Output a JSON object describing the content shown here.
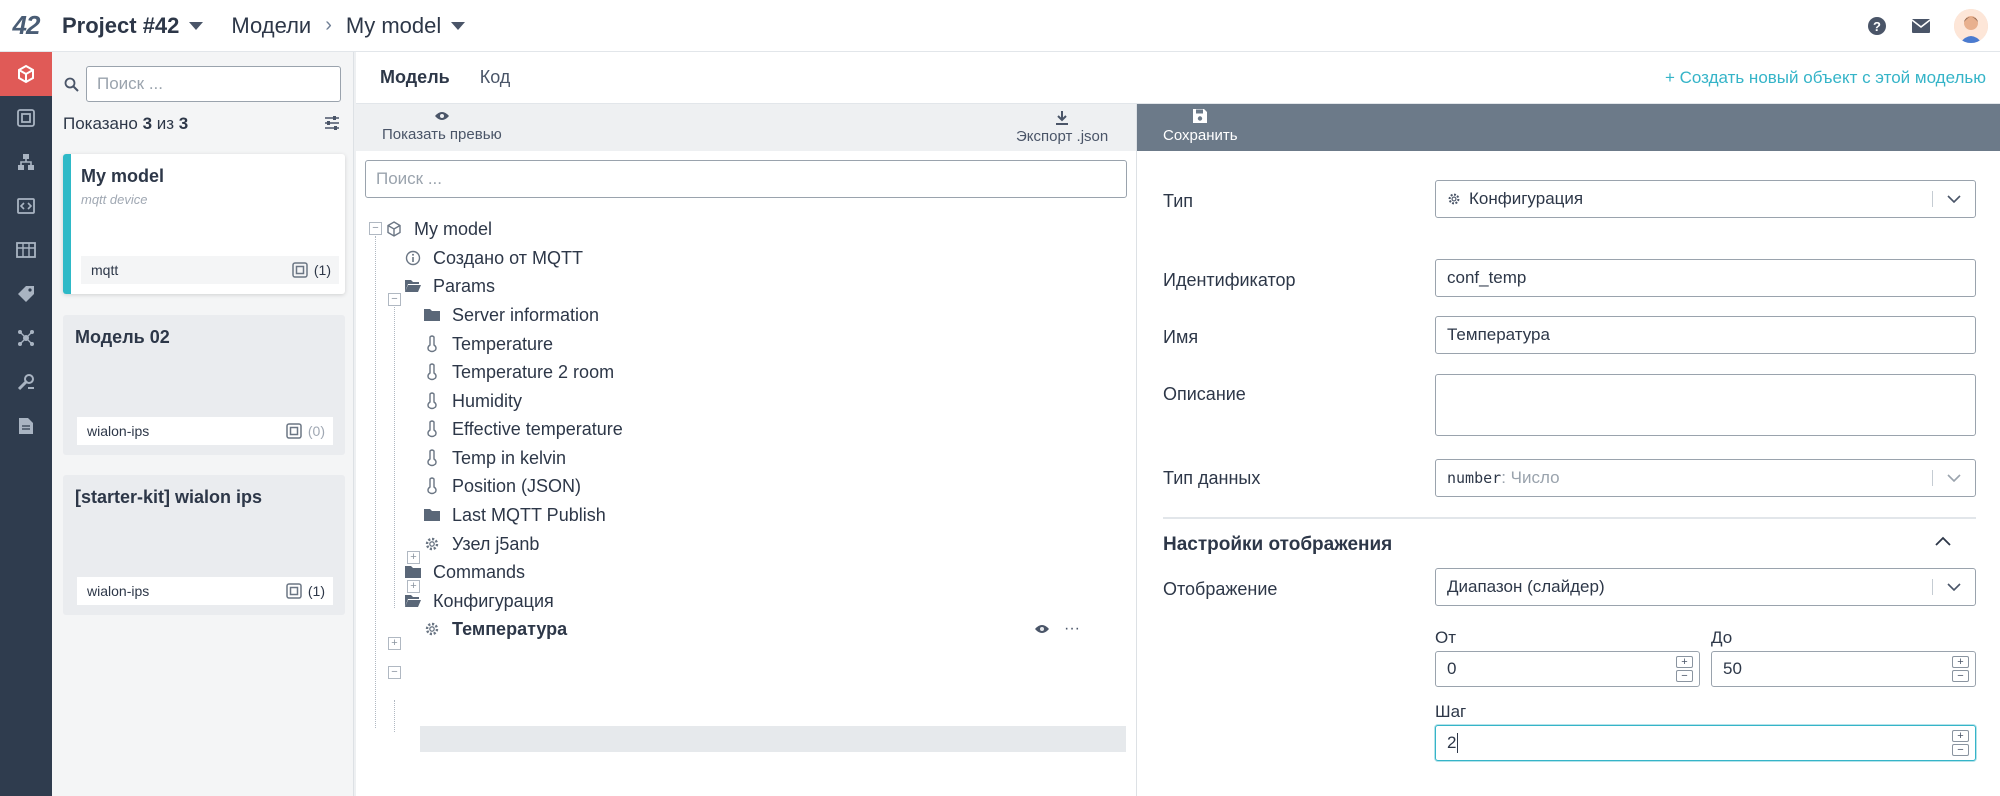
{
  "topbar": {
    "logo": "42",
    "project": "Project #42",
    "breadcrumb": [
      "Модели",
      "My model"
    ],
    "icons": [
      "help-icon",
      "mail-icon",
      "avatar"
    ]
  },
  "rail": {
    "items": [
      "cube-icon",
      "device-icon",
      "hierarchy-icon",
      "code-icon",
      "table-icon",
      "tag-icon",
      "network-icon",
      "tools-icon",
      "document-icon"
    ],
    "active_index": 0,
    "colors": {
      "bg": "#2f3c4e",
      "active": "#e05a57"
    }
  },
  "list": {
    "search_placeholder": "Поиск ...",
    "count_prefix": "Показано ",
    "count_shown": "3",
    "count_mid": " из ",
    "count_total": "3",
    "cards": [
      {
        "title": "My model",
        "subtitle": "mqtt device",
        "tag": "mqtt",
        "count": "(1)",
        "selected": true
      },
      {
        "title": "Модель 02",
        "subtitle": "",
        "tag": "wialon-ips",
        "count": "(0)",
        "selected": false
      },
      {
        "title": "[starter-kit] wialon ips",
        "subtitle": "",
        "tag": "wialon-ips",
        "count": "(1)",
        "selected": false
      }
    ]
  },
  "tabs": {
    "items": [
      "Модель",
      "Код"
    ],
    "active": "Модель",
    "create_link": "+ Создать новый объект с этой моделью",
    "accent": "#35b4c8"
  },
  "tree": {
    "preview_label": "Показать превью",
    "export_label": "Экспорт .json",
    "search_placeholder": "Поиск ...",
    "nodes": [
      {
        "label": "My model",
        "icon": "cube-icon"
      },
      {
        "label": "Создано от MQTT",
        "icon": "info-icon"
      },
      {
        "label": "Params",
        "icon": "folder-open-icon"
      },
      {
        "label": "Server information",
        "icon": "folder-icon"
      },
      {
        "label": "Temperature",
        "icon": "thermometer-icon"
      },
      {
        "label": "Temperature 2 room",
        "icon": "thermometer-icon"
      },
      {
        "label": "Humidity",
        "icon": "thermometer-icon"
      },
      {
        "label": "Effective temperature",
        "icon": "thermometer-icon"
      },
      {
        "label": "Temp in kelvin",
        "icon": "thermometer-icon"
      },
      {
        "label": "Position (JSON)",
        "icon": "thermometer-icon"
      },
      {
        "label": "Last MQTT Publish",
        "icon": "folder-icon"
      },
      {
        "label": "Узел j5anb",
        "icon": "gear-icon"
      },
      {
        "label": "Commands",
        "icon": "folder-icon"
      },
      {
        "label": "Конфигурация",
        "icon": "folder-open-icon"
      },
      {
        "label": "Температура",
        "icon": "gear-icon"
      }
    ],
    "selected_label": "Температура"
  },
  "editor": {
    "save_label": "Сохранить",
    "type_label": "Тип",
    "type_value": "Конфигурация",
    "id_label": "Идентификатор",
    "id_value": "conf_temp",
    "name_label": "Имя",
    "name_value": "Температура",
    "desc_label": "Описание",
    "desc_value": "",
    "datatype_label": "Тип данных",
    "datatype_code": "number",
    "datatype_text": " : Число",
    "display_section": "Настройки отображения",
    "display_label": "Отображение",
    "display_value": "Диапазон (слайдер)",
    "from_label": "От",
    "from_value": "0",
    "to_label": "До",
    "to_value": "50",
    "step_label": "Шаг",
    "step_value": "2"
  }
}
